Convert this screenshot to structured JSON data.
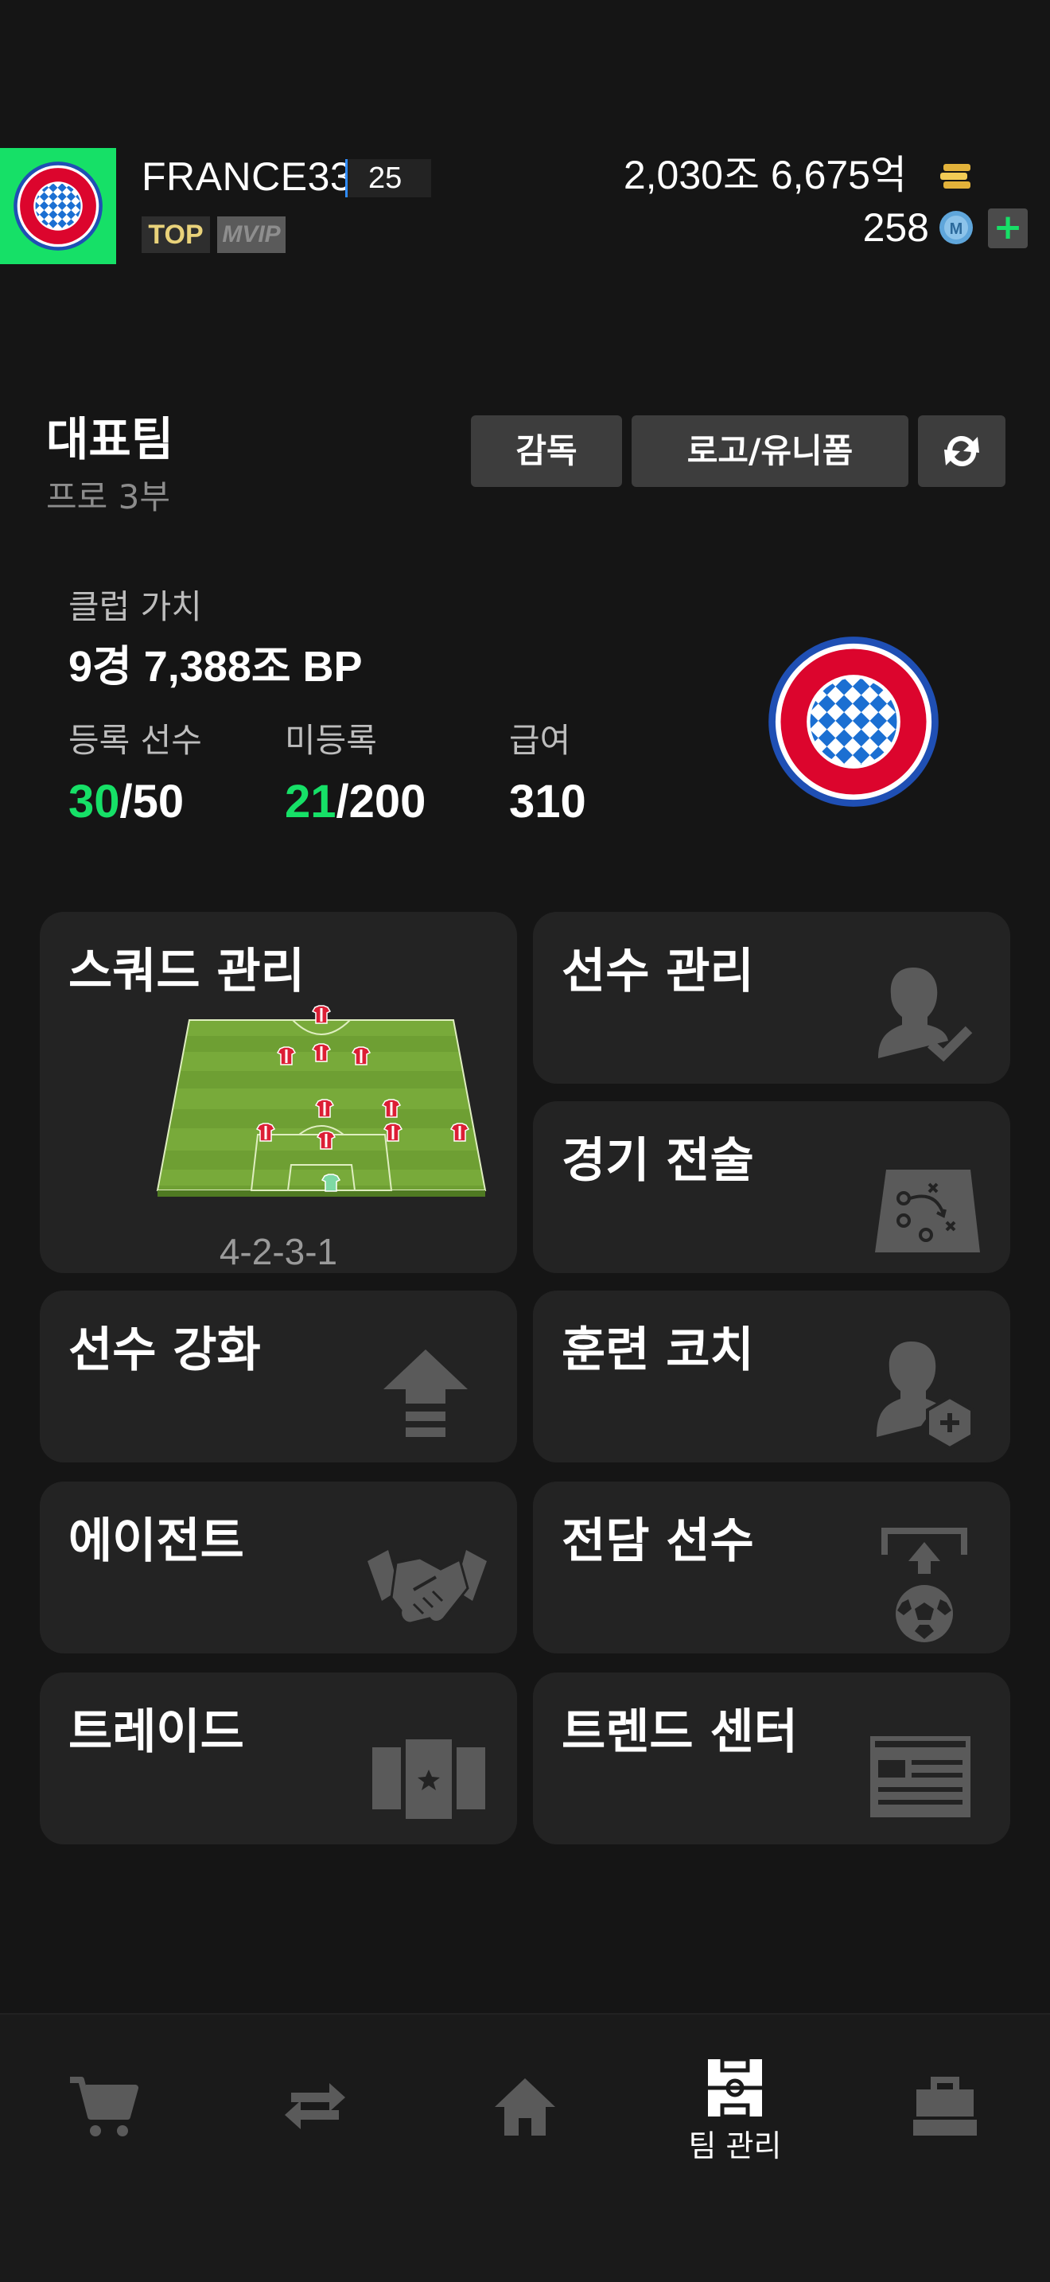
{
  "header": {
    "username": "FRANCE33",
    "level": "25",
    "badges": {
      "top": "TOP",
      "vip": "VIP"
    },
    "coins": "2,030조 6,675억",
    "mcoins": "258",
    "plus": "+"
  },
  "team": {
    "title": "대표팀",
    "division": "프로 3부",
    "buttons": {
      "manager": "감독",
      "logo_uniform": "로고/유니폼"
    },
    "club_value_label": "클럽 가치",
    "club_value": "9경 7,388조 BP",
    "registered": {
      "label": "등록 선수",
      "count": "30",
      "max": "/50"
    },
    "unregistered": {
      "label": "미등록",
      "count": "21",
      "max": "/200"
    },
    "salary": {
      "label": "급여",
      "value": "310"
    }
  },
  "tiles": {
    "squad": {
      "label": "스쿼드 관리",
      "formation": "4-2-3-1"
    },
    "players": {
      "label": "선수 관리"
    },
    "tactics": {
      "label": "경기 전술"
    },
    "enhance": {
      "label": "선수 강화"
    },
    "coach": {
      "label": "훈련 코치"
    },
    "agent": {
      "label": "에이전트"
    },
    "dedicated": {
      "label": "전담 선수"
    },
    "trade": {
      "label": "트레이드"
    },
    "trend": {
      "label": "트렌드 센터"
    }
  },
  "nav": {
    "active": "team",
    "items": [
      {
        "id": "shop",
        "icon": "cart-icon"
      },
      {
        "id": "transfer",
        "icon": "exchange-icon"
      },
      {
        "id": "home",
        "icon": "home-icon"
      },
      {
        "id": "team",
        "icon": "team-pitch-icon",
        "label": "팀 관리"
      },
      {
        "id": "inventory",
        "icon": "briefcase-icon"
      }
    ]
  },
  "colors": {
    "accent": "#16e067",
    "tile": "#232323",
    "background": "#151515"
  }
}
